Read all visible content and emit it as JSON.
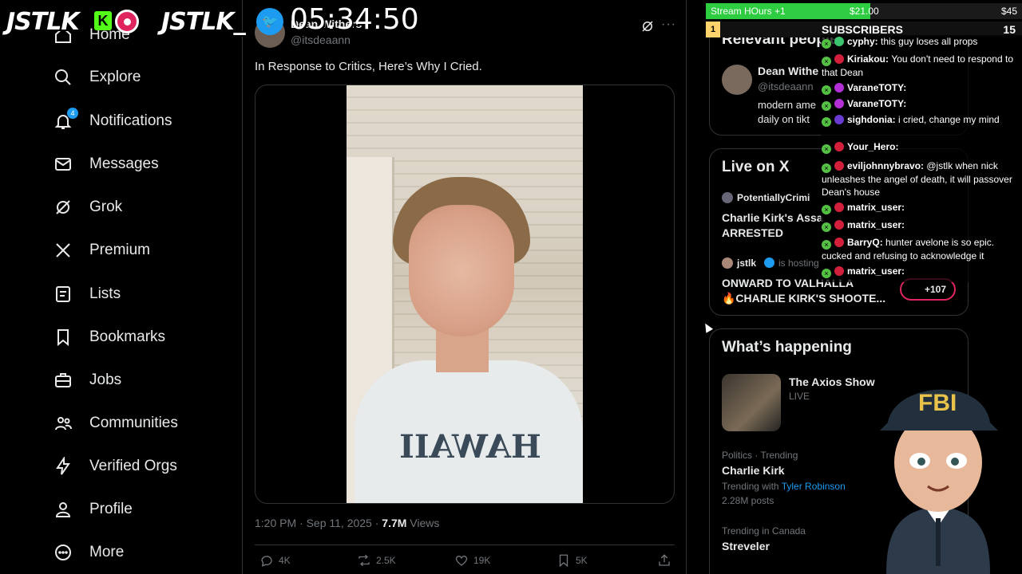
{
  "overlay": {
    "logo1": "JSTLK",
    "kick_letter": "K",
    "logo2": "JSTLK_",
    "clock": "05:34:50",
    "stream_label": "Stream HOurs +1",
    "stream_progress": 0.52,
    "stream_amount1": "$21.00",
    "stream_amount2": "$45",
    "subs_rank": "1",
    "subs_label": "SUBSCRIBERS",
    "subs_count": "15",
    "fbi_text": "FBI",
    "chat": [
      {
        "user": "cyphy:",
        "msg": "this guy loses all props",
        "color": "#3cc46e"
      },
      {
        "user": "Kiriakou:",
        "msg": "You don't need to respond to that Dean",
        "color": "#d21f3c"
      },
      {
        "user": "VaraneTOTY:",
        "msg": "",
        "color": "#b22fd6"
      },
      {
        "user": "VaraneTOTY:",
        "msg": "",
        "color": "#b22fd6"
      },
      {
        "user": "sighdonia:",
        "msg": "i cried, change my mind",
        "color": "#6a3bd1"
      },
      {
        "user": "Your_Hero:",
        "msg": "",
        "color": "#d21f3c"
      },
      {
        "user": "eviljohnnybravo:",
        "msg": "@jstlk when nick unleashes the angel of death, it will passover Dean's house",
        "color": "#d21f3c"
      },
      {
        "user": "matrix_user:",
        "msg": "",
        "color": "#d21f3c"
      },
      {
        "user": "matrix_user:",
        "msg": "",
        "color": "#d21f3c"
      },
      {
        "user": "BarryQ:",
        "msg": "hunter avelone is so epic. cucked and refusing to acknowledge it",
        "color": "#d21f3c"
      },
      {
        "user": "matrix_user:",
        "msg": "",
        "color": "#d21f3c"
      }
    ]
  },
  "nav": {
    "items": [
      {
        "label": "Home",
        "icon": "home-icon"
      },
      {
        "label": "Explore",
        "icon": "search-icon"
      },
      {
        "label": "Notifications",
        "icon": "bell-icon",
        "badge": "4"
      },
      {
        "label": "Messages",
        "icon": "envelope-icon"
      },
      {
        "label": "Grok",
        "icon": "grok-icon"
      },
      {
        "label": "Premium",
        "icon": "x-logo-icon"
      },
      {
        "label": "Lists",
        "icon": "list-icon"
      },
      {
        "label": "Bookmarks",
        "icon": "bookmark-icon"
      },
      {
        "label": "Jobs",
        "icon": "briefcase-icon"
      },
      {
        "label": "Communities",
        "icon": "people-icon"
      },
      {
        "label": "Verified Orgs",
        "icon": "lightning-icon"
      },
      {
        "label": "Profile",
        "icon": "person-icon"
      },
      {
        "label": "More",
        "icon": "more-circle-icon"
      }
    ]
  },
  "tweet": {
    "author_name": "Dean Withers",
    "handle": "@itsdeaann",
    "text": "In Response to Critics, Here’s Why I Cried.",
    "shirt_text": "HAWAII",
    "time": "1:20 PM · Sep 11, 2025 · ",
    "views_count": "7.7M",
    "views_label": " Views",
    "replies": "4K",
    "reposts": "2.5K",
    "likes": "19K",
    "bookmarks": "5K"
  },
  "right": {
    "relevant_title": "Relevant people",
    "rp_name": "Dean Withe",
    "rp_handle": "@itsdeaann",
    "rp_bio1": "modern ame",
    "rp_bio2": "daily on tikt",
    "live_title": "Live on X",
    "live1_host": "PotentiallyCrimi",
    "live1_title1": "Charlie Kirk's Assa",
    "live1_title2": "ARRESTED",
    "live2_host": "jstlk",
    "live2_hosting": "is hosting",
    "live2_title1": "ONWARD TO VALHALLA",
    "live2_title2": "🔥CHARLIE KIRK'S SHOOTE...",
    "live2_count": "+107",
    "happening_title": "What’s happening",
    "t1_name": "The Axios Show",
    "t1_status": "LIVE",
    "t2_cat": "Politics · Trending",
    "t2_name": "Charlie Kirk",
    "t2_with": "Trending with",
    "t2_link": "Tyler Robinson",
    "t2_posts": "2.28M posts",
    "t3_cat": "Trending in Canada",
    "t3_name": "Streveler"
  }
}
